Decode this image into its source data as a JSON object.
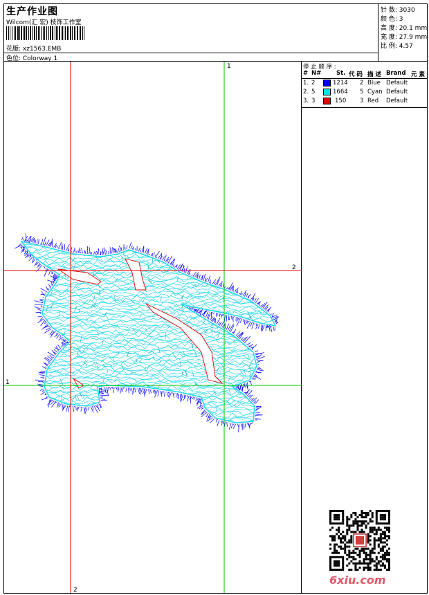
{
  "header": {
    "title": "生产作业图",
    "company": "Wilcom(汇 宏) 枝饰工作室",
    "file_line": "花版: xz1563.EMB",
    "colorway_line": "色位:  Colorway 1"
  },
  "stats": [
    {
      "label": "针 数:",
      "value": "3030"
    },
    {
      "label": "颜 色:",
      "value": "3"
    },
    {
      "label": "高 度:",
      "value": "20.1 mm"
    },
    {
      "label": "宽 度:",
      "value": "27.9 mm"
    },
    {
      "label": "比 例:",
      "value": "4.57"
    }
  ],
  "stop_sequence": {
    "title": "停 止 顺 序 :",
    "columns": [
      "#",
      "N#",
      "St.",
      "代 码",
      "描 述",
      "Brand",
      "元 素"
    ],
    "rows": [
      {
        "index": "1.",
        "n": "2",
        "color": "#0000ff",
        "stitches": "1214",
        "code": "2",
        "desc": "Blue",
        "brand": "Default"
      },
      {
        "index": "2.",
        "n": "5",
        "color": "#00e5e5",
        "stitches": "1664",
        "code": "5",
        "desc": "Cyan",
        "brand": "Default"
      },
      {
        "index": "3.",
        "n": "3",
        "color": "#e00000",
        "stitches": "150",
        "code": "3",
        "desc": "Red",
        "brand": "Default"
      }
    ]
  },
  "guides": {
    "vertical_red_label": "2",
    "vertical_green_label": "1",
    "horizontal_red_label": "2",
    "horizontal_green_label": "1"
  },
  "colors": {
    "red_guide": "#e00000",
    "green_guide": "#00c000",
    "blue_stitch": "#1010ff",
    "cyan_stitch": "#20d8e8"
  },
  "watermark": {
    "text": "6xiu.com"
  }
}
